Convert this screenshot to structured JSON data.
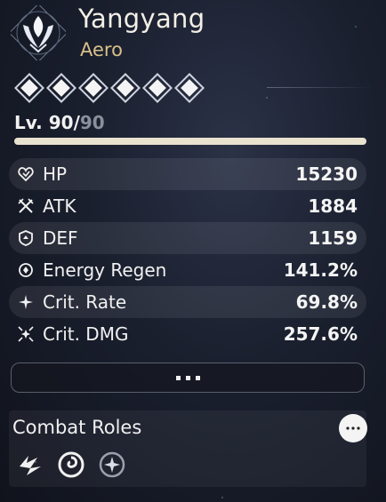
{
  "character": {
    "name": "Yangyang",
    "element": "Aero",
    "element_color": "#d7c08a",
    "emblem_icon": "aero-emblem-icon"
  },
  "sequence_nodes": {
    "count": 6,
    "icon": "diamond-node-icon"
  },
  "level": {
    "prefix": "Lv.",
    "current": "90",
    "separator": "/",
    "max": "90",
    "progress_percent": 100
  },
  "stats": [
    {
      "label": "HP",
      "value": "15230",
      "icon": "hp-heart-icon"
    },
    {
      "label": "ATK",
      "value": "1884",
      "icon": "atk-crossed-swords-icon"
    },
    {
      "label": "DEF",
      "value": "1159",
      "icon": "def-shield-icon"
    },
    {
      "label": "Energy Regen",
      "value": "141.2%",
      "icon": "energy-regen-icon"
    },
    {
      "label": "Crit. Rate",
      "value": "69.8%",
      "icon": "crit-rate-icon"
    },
    {
      "label": "Crit. DMG",
      "value": "257.6%",
      "icon": "crit-dmg-icon"
    }
  ],
  "more_button": {
    "icon": "ellipsis-icon"
  },
  "combat_roles": {
    "title": "Combat Roles",
    "more_icon": "ellipsis-icon",
    "roles": [
      {
        "icon": "role-burst-icon"
      },
      {
        "icon": "role-spiral-icon"
      },
      {
        "icon": "role-star-icon"
      }
    ]
  }
}
